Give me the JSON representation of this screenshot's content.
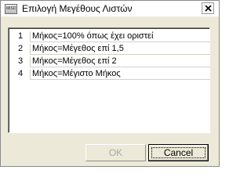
{
  "window": {
    "title": "Επιλογή Μεγέθους Λιστών",
    "app_icon_text": "MISD"
  },
  "list": {
    "items": [
      {
        "number": "1",
        "label": "Μήκος=100% όπως έχει οριστεί"
      },
      {
        "number": "2",
        "label": "Μήκος=Μέγεθος επί 1,5"
      },
      {
        "number": "3",
        "label": "Μήκος=Μέγεθος επί 2"
      },
      {
        "number": "4",
        "label": "Μήκος=Μέγιστο Μήκος"
      }
    ]
  },
  "buttons": {
    "ok_label": "OK",
    "ok_enabled": false,
    "cancel_label": "Cancel"
  },
  "icons": {
    "app": "app-icon",
    "close": "close-icon"
  }
}
